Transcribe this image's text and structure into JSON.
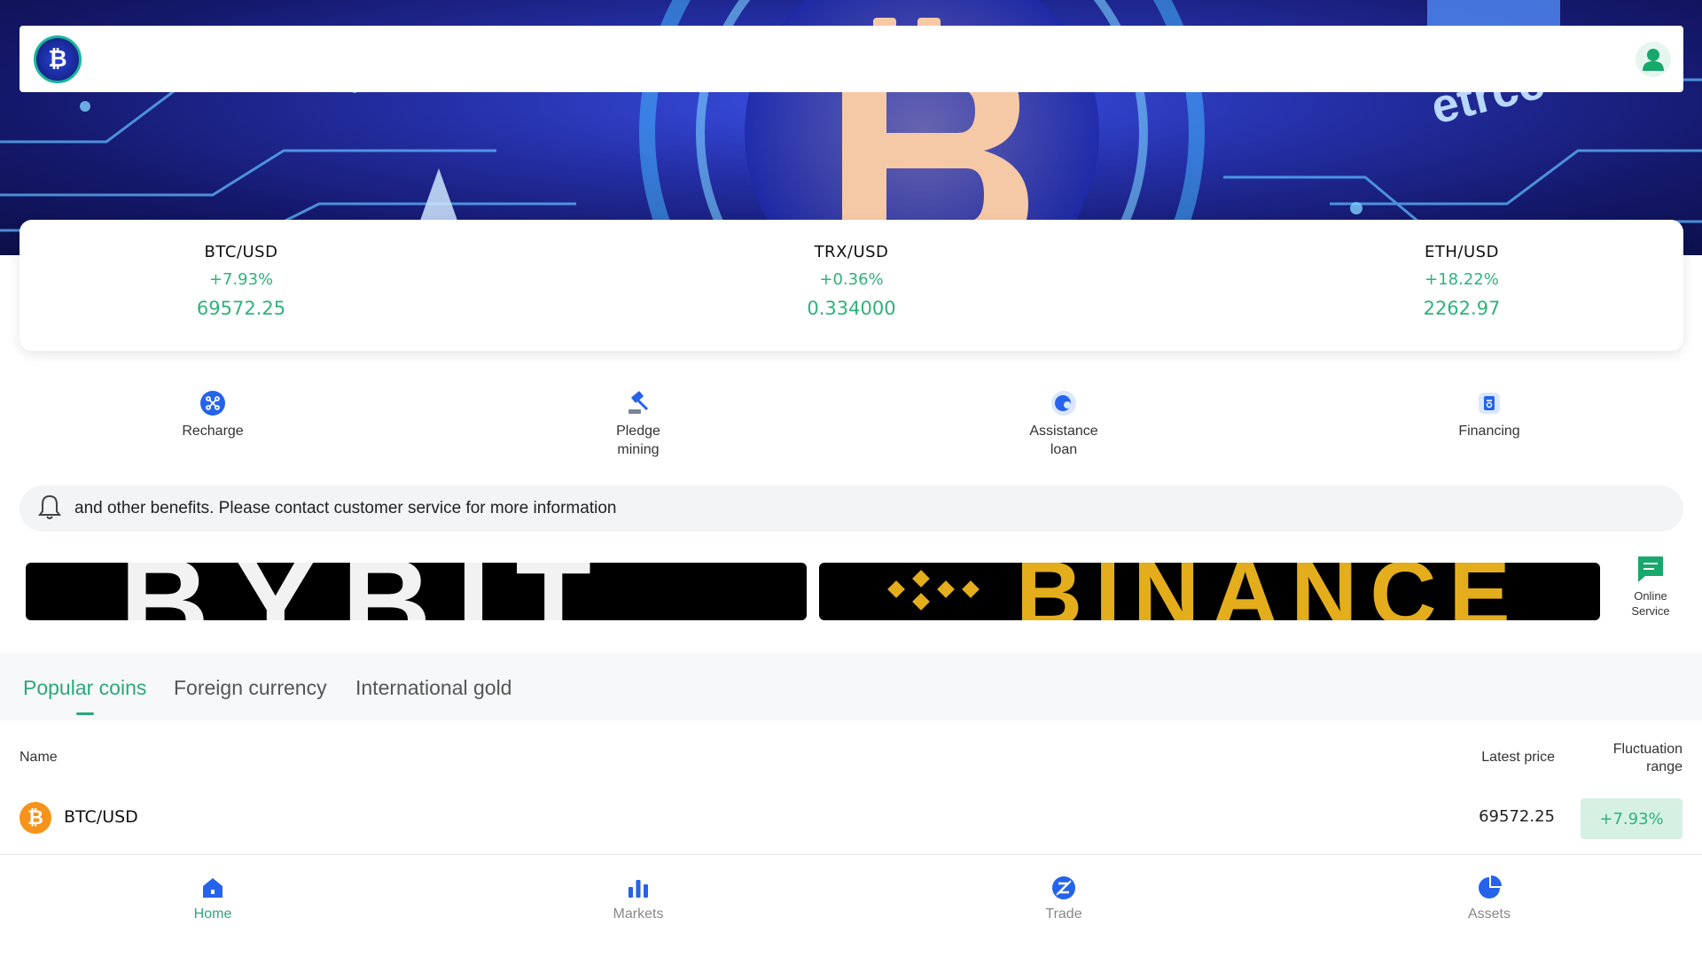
{
  "header": {
    "logo_icon": "bitcoin-logo-icon",
    "user_icon": "user-avatar-icon"
  },
  "hero": {
    "banner_text": "etrce"
  },
  "ticker": [
    {
      "pair": "BTC/USD",
      "change": "+7.93%",
      "price": "69572.25"
    },
    {
      "pair": "TRX/USD",
      "change": "+0.36%",
      "price": "0.334000"
    },
    {
      "pair": "ETH/USD",
      "change": "+18.22%",
      "price": "2262.97"
    }
  ],
  "actions": [
    {
      "label": "Recharge",
      "icon": "recharge-icon"
    },
    {
      "label": "Pledge mining",
      "icon": "pickaxe-icon"
    },
    {
      "label": "Assistance loan",
      "icon": "loan-icon"
    },
    {
      "label": "Financing",
      "icon": "financing-icon"
    }
  ],
  "notice": {
    "icon": "bell-icon",
    "text": "and other benefits. Please contact customer service for more information"
  },
  "banners": {
    "bybit": "BYBIT",
    "binance": "BINANCE"
  },
  "online_service": {
    "label": "Online Service",
    "icon": "chat-icon"
  },
  "tabs": [
    {
      "label": "Popular coins",
      "active": true
    },
    {
      "label": "Foreign currency",
      "active": false
    },
    {
      "label": "International gold",
      "active": false
    }
  ],
  "table": {
    "headers": {
      "name": "Name",
      "price": "Latest price",
      "range": "Fluctuation range"
    },
    "rows": [
      {
        "name": "BTC/USD",
        "price": "69572.25",
        "range": "+7.93%",
        "icon": "bitcoin-icon"
      }
    ]
  },
  "bottom_nav": [
    {
      "label": "Home",
      "icon": "home-icon",
      "active": true
    },
    {
      "label": "Markets",
      "icon": "bar-chart-icon",
      "active": false
    },
    {
      "label": "Trade",
      "icon": "trade-icon",
      "active": false
    },
    {
      "label": "Assets",
      "icon": "pie-chart-icon",
      "active": false
    }
  ],
  "colors": {
    "accent_green": "#2db37a",
    "tab_active": "#2aa87a",
    "icon_blue": "#2563eb",
    "hero_blue": "#2530a8"
  }
}
